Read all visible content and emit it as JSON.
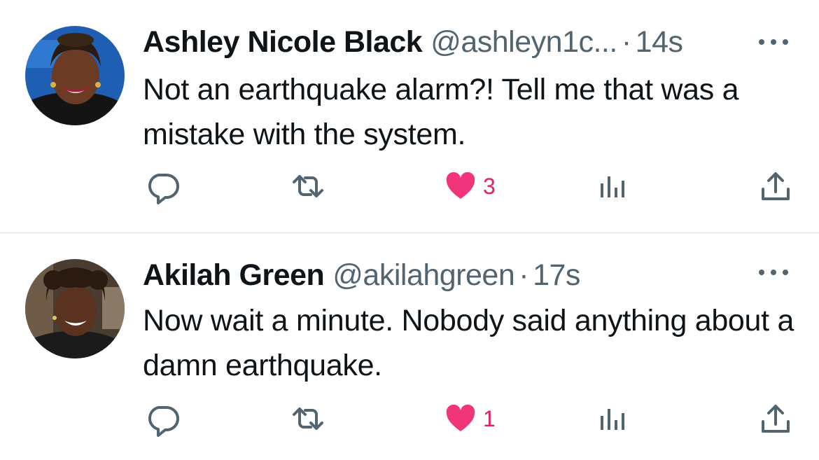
{
  "tweets": [
    {
      "name": "Ashley Nicole Black",
      "handle": "@ashleyn1c...",
      "separator": "·",
      "time": "14s",
      "text": "Not an earthquake alarm?! Tell me that was a mistake with the system.",
      "likes": "3",
      "liked": true
    },
    {
      "name": "Akilah Green",
      "handle": "@akilahgreen",
      "separator": "·",
      "time": "17s",
      "text": "Now wait a minute. Nobody said anything about a damn earthquake.",
      "likes": "1",
      "liked": true
    }
  ],
  "colors": {
    "text": "#0f1419",
    "secondary": "#536471",
    "like": "#f0357a",
    "divider": "#e3e6e9"
  },
  "icons": [
    "reply-icon",
    "retweet-icon",
    "heart-icon",
    "views-icon",
    "share-icon",
    "more-icon"
  ]
}
